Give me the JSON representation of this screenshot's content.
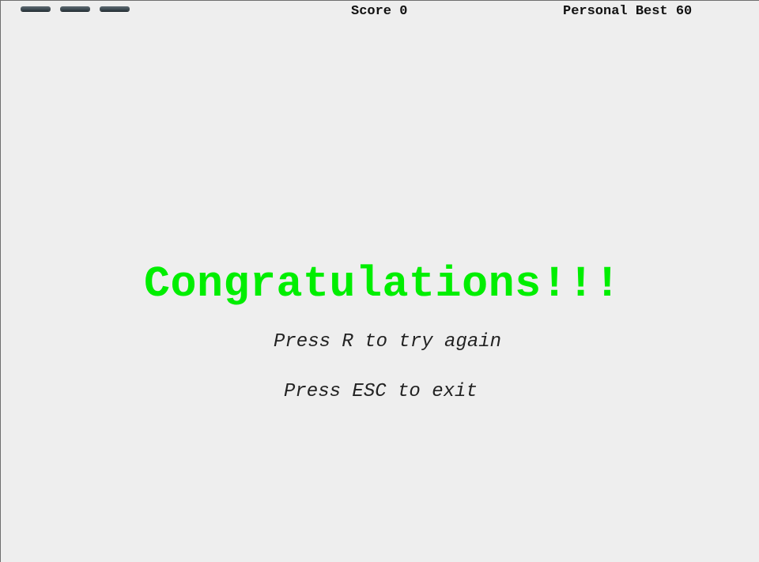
{
  "hud": {
    "lives_remaining": 3,
    "score_label": "Score",
    "score_value": "0",
    "best_label": "Personal Best",
    "best_value": "60"
  },
  "message": {
    "title": "Congratulations!!!",
    "title_color": "#00ee00",
    "retry_hint": "Press R to try again",
    "exit_hint": "Press ESC to exit"
  },
  "colors": {
    "background": "#eeeeee",
    "life_bar": "#37444b"
  }
}
